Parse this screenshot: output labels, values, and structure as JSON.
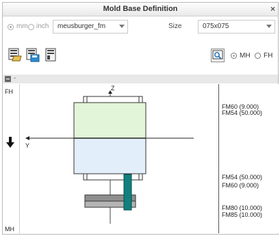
{
  "window": {
    "title": "Mold Base Definition",
    "close_label": "×"
  },
  "units": {
    "mm_label": "mm",
    "inch_label": "inch"
  },
  "supplier": {
    "value": "meusburger_fm"
  },
  "size": {
    "label": "Size",
    "value": "075x075"
  },
  "orientation": {
    "mh_label": "MH",
    "fh_label": "FH"
  },
  "panel": {
    "collapse_label": "-"
  },
  "side_labels": {
    "top": "FH",
    "bottom": "MH"
  },
  "axes": {
    "z": "Z",
    "y": "Y"
  },
  "plates": [
    {
      "label": "FM60 (9.000)"
    },
    {
      "label": "FM54 (50.000)"
    },
    {
      "label": "FM54 (50.000)"
    },
    {
      "label": "FM60 (9.000)"
    },
    {
      "label": "FM80 (10.000)"
    },
    {
      "label": "FM85 (10.000)"
    }
  ],
  "colors": {
    "upper_plate": "#e2f5d9",
    "lower_plate": "#e2eefa",
    "ejector_pin": "#127f7f",
    "ejector_plate": "#8f8f8f"
  },
  "icons": {
    "load": "load-assembly-icon",
    "save": "save-assembly-icon",
    "properties": "properties-icon",
    "preview": "preview-icon",
    "down_arrow": "arrow-down-icon"
  }
}
